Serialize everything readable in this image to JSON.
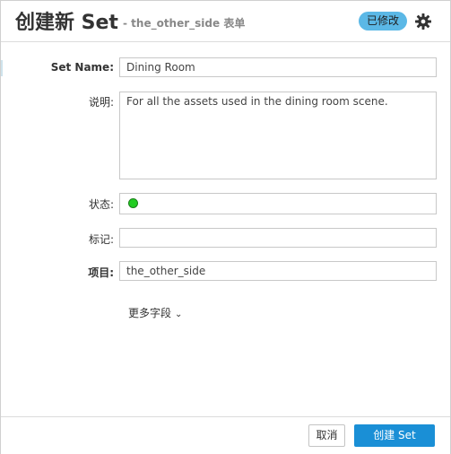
{
  "header": {
    "title": "创建新 Set",
    "subtitle": "- the_other_side 表单",
    "badge": "已修改",
    "gear_icon": "gear-icon"
  },
  "form": {
    "set_name": {
      "label": "Set Name:",
      "value": "Dining Room"
    },
    "description": {
      "label": "说明:",
      "value": "For all the assets used in the dining room scene."
    },
    "status": {
      "label": "状态:",
      "color": "#22cc22"
    },
    "tags": {
      "label": "标记:",
      "value": ""
    },
    "project": {
      "label": "项目:",
      "value": "the_other_side"
    },
    "more_fields": "更多字段"
  },
  "footer": {
    "cancel": "取消",
    "create": "创建 Set"
  },
  "colors": {
    "accent": "#1a8fd6",
    "badge": "#5bb8e6"
  }
}
